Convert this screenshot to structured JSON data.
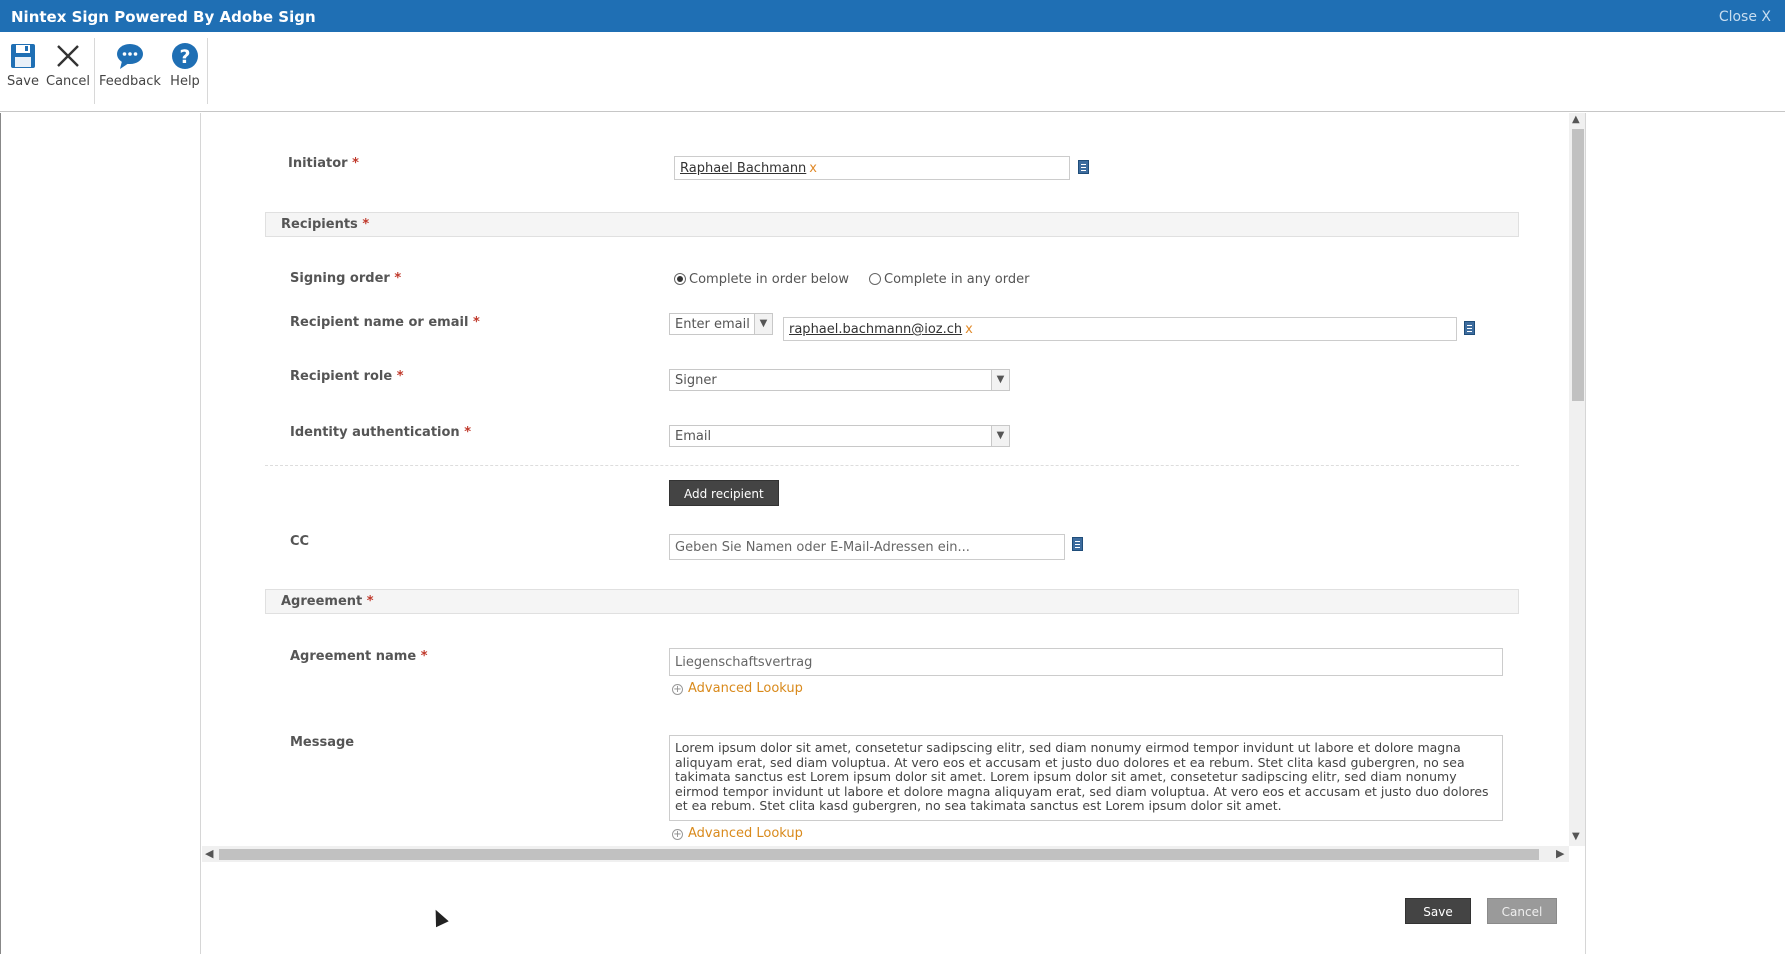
{
  "window": {
    "title": "Nintex Sign Powered By Adobe Sign",
    "close_label": "Close X"
  },
  "ribbon": {
    "save_label": "Save",
    "cancel_label": "Cancel",
    "feedback_label": "Feedback",
    "help_label": "Help"
  },
  "form": {
    "initiator_label": "Initiator",
    "initiator_value": "Raphael Bachmann",
    "recipients_section": "Recipients",
    "signing_order_label": "Signing order",
    "signing_order_options": [
      "Complete in order below",
      "Complete in any order"
    ],
    "signing_order_selected": 0,
    "recipient_label": "Recipient name or email",
    "recipient_type_select": "Enter email",
    "recipient_value": "raphael.bachmann@ioz.ch",
    "recipient_role_label": "Recipient role",
    "recipient_role_value": "Signer",
    "identity_label": "Identity authentication",
    "identity_value": "Email",
    "add_recipient_label": "Add recipient",
    "cc_label": "CC",
    "cc_placeholder": "Geben Sie Namen oder E-Mail-Adressen ein...",
    "agreement_section": "Agreement",
    "agreement_name_label": "Agreement name",
    "agreement_name_value": "Liegenschaftsvertrag",
    "advanced_lookup_label": "Advanced Lookup",
    "message_label": "Message",
    "message_value": "Lorem ipsum dolor sit amet, consetetur sadipscing elitr, sed diam nonumy eirmod tempor invidunt ut labore et dolore magna aliquyam erat, sed diam voluptua. At vero eos et accusam et justo duo dolores et ea rebum. Stet clita kasd gubergren, no sea takimata sanctus est Lorem ipsum dolor sit amet. Lorem ipsum dolor sit amet, consetetur sadipscing elitr, sed diam nonumy eirmod tempor invidunt ut labore et dolore magna aliquyam erat, sed diam voluptua. At vero eos et accusam et justo duo dolores et ea rebum. Stet clita kasd gubergren, no sea takimata sanctus est Lorem ipsum dolor sit amet."
  },
  "footer": {
    "save_label": "Save",
    "cancel_label": "Cancel"
  },
  "colors": {
    "titlebar": "#1f6fb4",
    "icon_blue": "#1f6fb4",
    "link_orange": "#d98a1c",
    "required_red": "#c0392b"
  }
}
